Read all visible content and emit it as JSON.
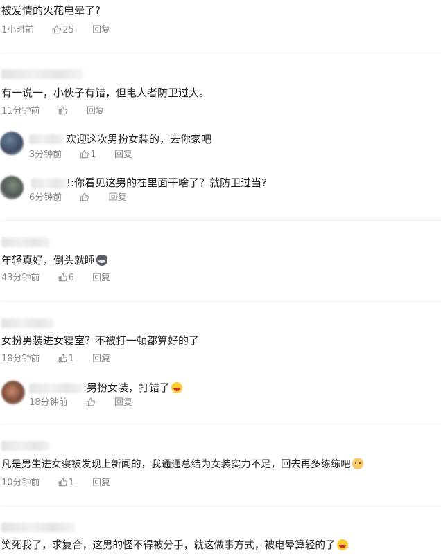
{
  "comments": [
    {
      "text": "被爱情的火花电晕了?",
      "time": "1小时前",
      "likes": "25",
      "reply": "回复"
    },
    {
      "text": "有一说一，小伙子有错，但电人者防卫过大。",
      "time": "11分钟前",
      "likes": "",
      "reply": "回复"
    },
    {
      "text": "欢迎这次男扮女装的，去你家吧",
      "time": "3分钟前",
      "likes": "1",
      "reply": "回复"
    },
    {
      "text": "!:你看见这男的在里面干啥了？就防卫过当?",
      "time": "6分钟前",
      "likes": "",
      "reply": "回复"
    },
    {
      "text": "年轻真好，倒头就睡",
      "time": "43分钟前",
      "likes": "6",
      "reply": "回复"
    },
    {
      "text": "女扮男装进女寝室？不被打一顿都算好的了",
      "time": "18分钟前",
      "likes": "1",
      "reply": "回复"
    },
    {
      "text": ":男扮女装，打错了",
      "time": "18分钟前",
      "likes": "",
      "reply": "回复"
    },
    {
      "text": "凡是男生进女寝被发现上新闻的，我通通总结为女装实力不足，回去再多练练吧",
      "time": "10分钟前",
      "likes": "1",
      "reply": "回复"
    },
    {
      "text": "笑死我了，求复合，这男的怪不得被分手，就这做事方式，被电晕算轻的了",
      "time": "",
      "likes": "",
      "reply": ""
    }
  ],
  "icons": {
    "like": "thumbs-up-icon"
  },
  "colors": {
    "text": "#222222",
    "meta": "#8a8a8a",
    "divider": "#f0f0f0"
  }
}
